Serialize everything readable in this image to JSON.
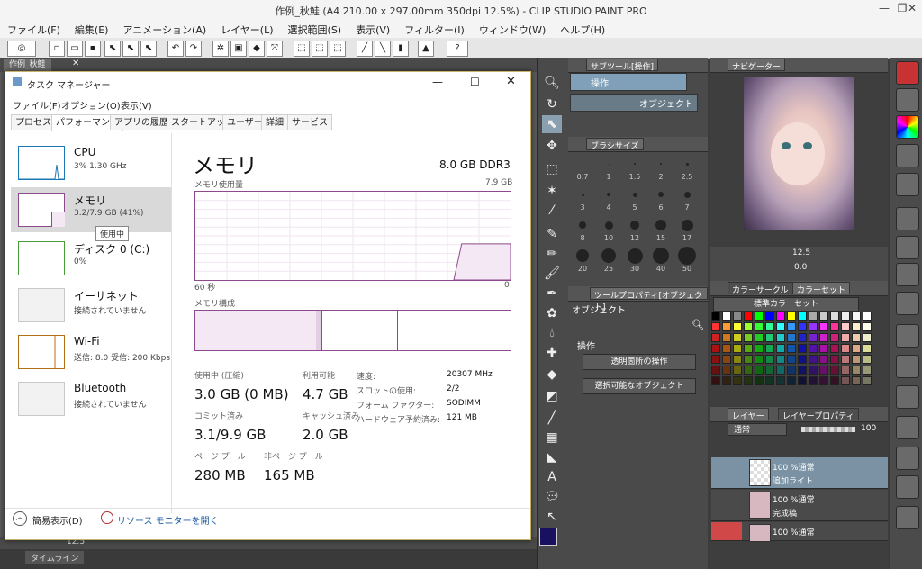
{
  "app": {
    "title": "作例_秋鮭 (A4 210.00 x 297.00mm 350dpi 12.5%) - CLIP STUDIO PAINT PRO",
    "menu": [
      "ファイル(F)",
      "編集(E)",
      "アニメーション(A)",
      "レイヤー(L)",
      "選択範囲(S)",
      "表示(V)",
      "フィルター(I)",
      "ウィンドウ(W)",
      "ヘルプ(H)"
    ],
    "doc_tab": "作例_秋鮭",
    "zoom": "12.5",
    "timeline_label": "タイムライン"
  },
  "subtool": {
    "header": "サブツール[操作]",
    "items": [
      "操作",
      "オブジェクト"
    ]
  },
  "brushsize": {
    "header": "ブラシサイズ",
    "sizes": [
      "0.7",
      "1",
      "1.5",
      "2",
      "2.5",
      "3",
      "4",
      "5",
      "6",
      "7",
      "8",
      "10",
      "12",
      "15",
      "17",
      "20",
      "25",
      "30",
      "40",
      "50"
    ]
  },
  "toolprop": {
    "header": "ツールプロパティ[オブジェクト]",
    "title": "オブジェクト",
    "section": "操作",
    "select1": "透明箇所の操作",
    "select2": "選択可能なオブジェクト"
  },
  "navigator": {
    "header": "ナビゲーター",
    "zoom": "12.5",
    "rotate": "0.0"
  },
  "colorset": {
    "tabs": [
      "カラーサークル",
      "カラーセット"
    ],
    "set_name": "標準カラーセット"
  },
  "layers": {
    "tabs": [
      "レイヤー",
      "レイヤープロパティ"
    ],
    "blend": "通常",
    "opacity": "100",
    "items": [
      {
        "mode": "100 %通常",
        "name": "追加ライト"
      },
      {
        "mode": "100 %通常",
        "name": "完成稿"
      },
      {
        "mode": "100 %通常",
        "name": ""
      }
    ]
  },
  "taskmgr": {
    "title": "タスク マネージャー",
    "menu": [
      "ファイル(F)",
      "オプション(O)",
      "表示(V)"
    ],
    "tabs": [
      "プロセス",
      "パフォーマンス",
      "アプリの履歴",
      "スタートアップ",
      "ユーザー",
      "詳細",
      "サービス"
    ],
    "resources": [
      {
        "name": "CPU",
        "sub": "3%  1.30 GHz"
      },
      {
        "name": "メモリ",
        "sub": "3.2/7.9 GB (41%)"
      },
      {
        "name": "ディスク 0 (C:)",
        "sub": "0%"
      },
      {
        "name": "イーサネット",
        "sub": "接続されていません"
      },
      {
        "name": "Wi-Fi",
        "sub": "送信: 8.0  受信: 200 Kbps"
      },
      {
        "name": "Bluetooth",
        "sub": "接続されていません"
      }
    ],
    "tooltip": "使用中",
    "heading": "メモリ",
    "capacity": "8.0 GB DDR3",
    "usage_label": "メモリ使用量",
    "usage_max": "7.9 GB",
    "axis_left": "60 秒",
    "axis_right": "0",
    "composition_label": "メモリ構成",
    "stats": [
      {
        "label": "使用中 (圧縮)",
        "value": "3.0 GB (0 MB)"
      },
      {
        "label": "利用可能",
        "value": "4.7 GB"
      },
      {
        "label": "コミット済み",
        "value": "3.1/9.9 GB"
      },
      {
        "label": "キャッシュ済み",
        "value": "2.0 GB"
      },
      {
        "label": "ページ プール",
        "value": "280 MB"
      },
      {
        "label": "非ページ プール",
        "value": "165 MB"
      }
    ],
    "details": [
      {
        "label": "速度:",
        "value": "20307 MHz"
      },
      {
        "label": "スロットの使用:",
        "value": "2/2"
      },
      {
        "label": "フォーム ファクター:",
        "value": "SODIMM"
      },
      {
        "label": "ハードウェア予約済み:",
        "value": "121 MB"
      }
    ],
    "footer_brief": "簡易表示(D)",
    "footer_monitor": "リソース モニターを開く",
    "usage_fraction": 0.41
  },
  "colors": {
    "accent_purple": "#8b4a8b",
    "cpu_blue": "#1a78b4",
    "disk_green": "#4a9a3a",
    "wifi_orange": "#b46e14"
  }
}
